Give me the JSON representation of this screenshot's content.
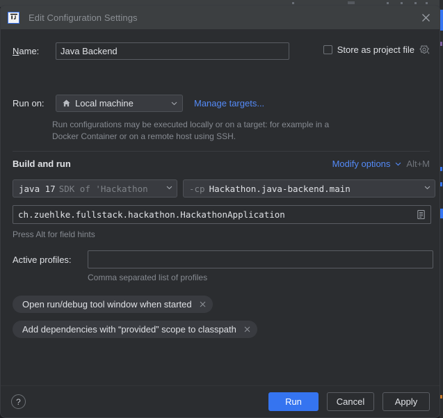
{
  "window": {
    "title": "Edit Configuration Settings",
    "logo_icon": "intellij-idea-logo-icon",
    "close_icon": "close-icon"
  },
  "form": {
    "name": {
      "label_mnemonic": "N",
      "label_rest": "ame:",
      "value": "Java Backend",
      "placeholder": ""
    },
    "store_as_project_file": {
      "label": "Store as project file",
      "checked": false,
      "gear_icon": "gear-icon"
    },
    "run_on": {
      "label": "Run on:",
      "value": "Local machine",
      "value_icon": "home-icon",
      "chevron_icon": "chevron-down-icon",
      "manage_targets_link": "Manage targets..."
    },
    "hint": "Run configurations may be executed locally or on a target: for example in a Docker Container or on a remote host using SSH."
  },
  "build_and_run": {
    "section_title": "Build and run",
    "modify_options_link": "Modify options",
    "modify_options_chevron_icon": "chevron-down-icon",
    "modify_options_shortcut": "Alt+M",
    "sdk": {
      "primary": "java 17",
      "secondary": "SDK of 'Hackathon",
      "chevron_icon": "chevron-down-icon"
    },
    "classpath": {
      "flag": "-cp",
      "value": "Hackathon.java-backend.main",
      "chevron_icon": "chevron-down-icon"
    },
    "main_class": {
      "value": "ch.zuehlke.fullstack.hackathon.HackathonApplication",
      "placeholder": "",
      "browse_icon": "list-document-icon"
    },
    "alt_hint": "Press Alt for field hints",
    "active_profiles": {
      "label": "Active profiles:",
      "value": "",
      "placeholder": "",
      "hint": "Comma separated list of profiles"
    },
    "option_chips": [
      {
        "label": "Open run/debug tool window when started",
        "remove_icon": "close-icon"
      },
      {
        "label": "Add dependencies with “provided” scope to classpath",
        "remove_icon": "close-icon"
      }
    ]
  },
  "footer": {
    "help_label": "?",
    "help_icon": "help-icon",
    "run_label": "Run",
    "cancel_label": "Cancel",
    "apply_label": "Apply"
  },
  "colors": {
    "accent_blue": "#3574f0",
    "link_blue": "#548af7",
    "dialog_bg": "#2b2d30",
    "titlebar_bg": "#3c3f41",
    "field_bg": "#393b40",
    "text_primary": "#dfe1e5",
    "text_muted": "#868a91"
  }
}
